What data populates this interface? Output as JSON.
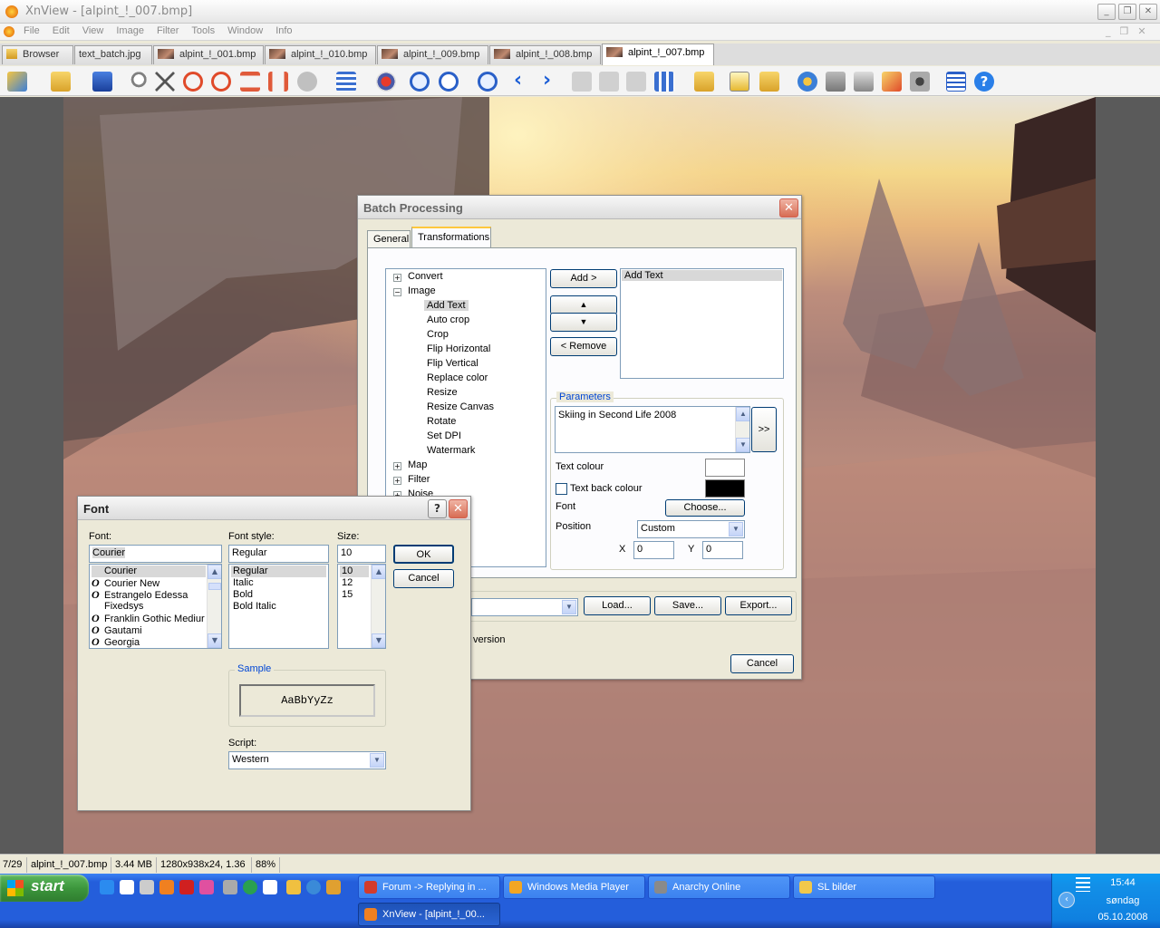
{
  "window": {
    "title": "XnView - [alpint_!_007.bmp]"
  },
  "menu": [
    "File",
    "Edit",
    "View",
    "Image",
    "Filter",
    "Tools",
    "Window",
    "Info"
  ],
  "tabs": [
    {
      "label": "Browser"
    },
    {
      "label": "text_batch.jpg"
    },
    {
      "label": "alpint_!_001.bmp"
    },
    {
      "label": "alpint_!_010.bmp"
    },
    {
      "label": "alpint_!_009.bmp"
    },
    {
      "label": "alpint_!_008.bmp"
    },
    {
      "label": "alpint_!_007.bmp"
    }
  ],
  "batch": {
    "title": "Batch Processing",
    "tabs": [
      "General",
      "Transformations"
    ],
    "tree": {
      "convert": "Convert",
      "image": "Image",
      "image_children": [
        "Add Text",
        "Auto crop",
        "Crop",
        "Flip Horizontal",
        "Flip Vertical",
        "Replace color",
        "Resize",
        "Resize Canvas",
        "Rotate",
        "Set DPI",
        "Watermark"
      ],
      "map": "Map",
      "filter": "Filter",
      "noise": "Noise"
    },
    "buttons": {
      "add": "Add >",
      "up": "▲",
      "down": "▼",
      "remove": "< Remove",
      "more": ">>",
      "choose": "Choose...",
      "load": "Load...",
      "save": "Save...",
      "export": "Export...",
      "cancel": "Cancel"
    },
    "actions": [
      "Add Text"
    ],
    "params": {
      "title": "Parameters",
      "text_value": "Skiing in Second Life 2008",
      "text_colour_label": "Text colour",
      "text_colour": "#ffffff",
      "text_back_label": "Text back colour",
      "text_back_colour": "#000000",
      "font_label": "Font",
      "position_label": "Position",
      "position_value": "Custom",
      "x_label": "X",
      "x_value": "0",
      "y_label": "Y",
      "y_value": "0"
    },
    "bottom_partial": "version"
  },
  "font_dialog": {
    "title": "Font",
    "font_label": "Font:",
    "font_value": "Courier",
    "fonts": [
      {
        "name": "Courier",
        "type": ""
      },
      {
        "name": "Courier New",
        "type": "O"
      },
      {
        "name": "Estrangelo Edessa",
        "type": "O"
      },
      {
        "name": "Fixedsys",
        "type": ""
      },
      {
        "name": "Franklin Gothic Mediur",
        "type": "O"
      },
      {
        "name": "Gautami",
        "type": "O"
      },
      {
        "name": "Georgia",
        "type": "O"
      }
    ],
    "style_label": "Font style:",
    "style_value": "Regular",
    "styles": [
      "Regular",
      "Italic",
      "Bold",
      "Bold Italic"
    ],
    "size_label": "Size:",
    "size_value": "10",
    "sizes": [
      "10",
      "12",
      "15"
    ],
    "ok": "OK",
    "cancel": "Cancel",
    "sample_title": "Sample",
    "sample_text": "AaBbYyZz",
    "script_label": "Script:",
    "script_value": "Western"
  },
  "status": {
    "index": "7/29",
    "file": "alpint_!_007.bmp",
    "size": "3.44 MB",
    "dims": "1280x938x24, 1.36",
    "zoom": "88%"
  },
  "taskbar": {
    "start": "start",
    "tasks": [
      {
        "label": "Forum -> Replying in ...",
        "color": "#d33b2c"
      },
      {
        "label": "Windows Media Player",
        "color": "#f3a623"
      },
      {
        "label": "Anarchy Online",
        "color": "#8a8a8a"
      },
      {
        "label": "SL bilder",
        "color": "#f1c84b"
      },
      {
        "label": "XnView - [alpint_!_00...",
        "color": "#f08020"
      }
    ],
    "clock": {
      "time": "15:44",
      "day": "søndag",
      "date": "05.10.2008"
    }
  }
}
